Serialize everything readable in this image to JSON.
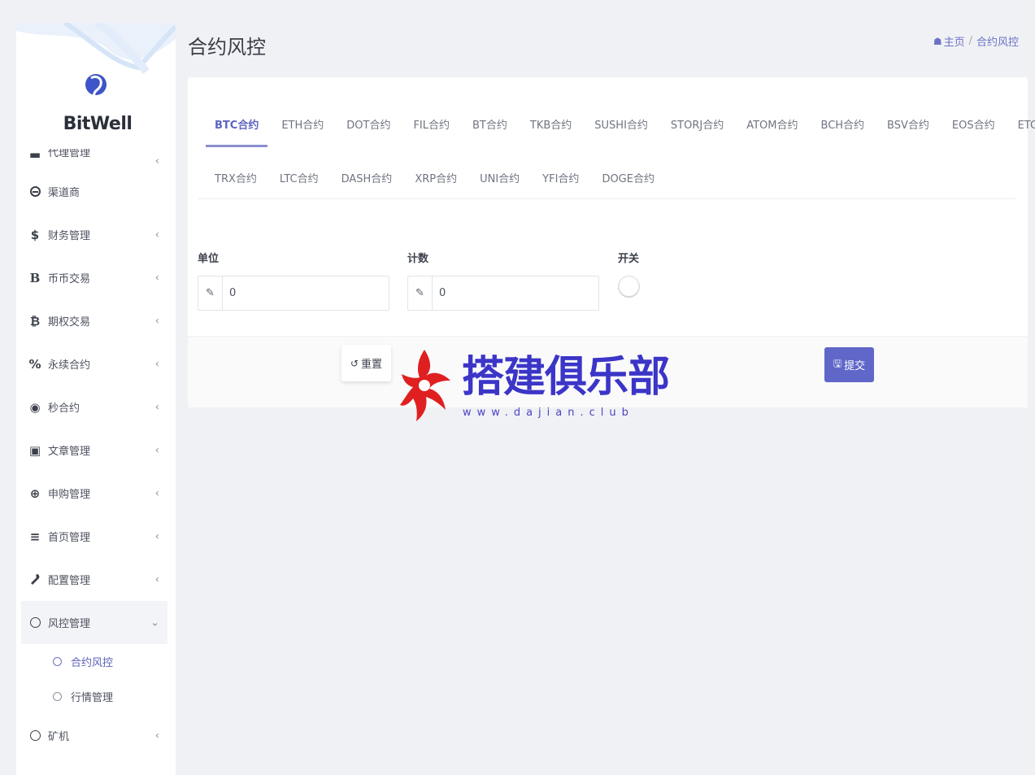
{
  "brand": {
    "name": "BitWell"
  },
  "sidebar": {
    "partial_item": {
      "label": "代理管理"
    },
    "items": [
      {
        "label": "渠道商",
        "icon": "person-icon",
        "glyph": "⊖",
        "has_children": false
      },
      {
        "label": "财务管理",
        "icon": "dollar-icon",
        "glyph": "$",
        "has_children": true
      },
      {
        "label": "币币交易",
        "icon": "b-letter-icon",
        "glyph": "B",
        "has_children": true
      },
      {
        "label": "期权交易",
        "icon": "bitcoin-icon",
        "glyph": "₿",
        "has_children": true
      },
      {
        "label": "永续合约",
        "icon": "percent-icon",
        "glyph": "%",
        "has_children": true
      },
      {
        "label": "秒合约",
        "icon": "target-icon",
        "glyph": "◉",
        "has_children": true
      },
      {
        "label": "文章管理",
        "icon": "newspaper-icon",
        "glyph": "▣",
        "has_children": true
      },
      {
        "label": "申购管理",
        "icon": "lifebuoy-icon",
        "glyph": "⊕",
        "has_children": true
      },
      {
        "label": "首页管理",
        "icon": "list-icon",
        "glyph": "≡",
        "has_children": true
      },
      {
        "label": "配置管理",
        "icon": "wrench-icon",
        "glyph": "🔧",
        "has_children": true
      }
    ],
    "open_item": {
      "label": "风控管理",
      "icon": "circle-icon"
    },
    "sub_items": [
      {
        "label": "合约风控",
        "active": true
      },
      {
        "label": "行情管理",
        "active": false
      }
    ],
    "last_item": {
      "label": "矿机",
      "icon": "circle-icon"
    }
  },
  "header": {
    "title": "合约风控",
    "breadcrumb": {
      "home": "主页",
      "current": "合约风控"
    }
  },
  "tabs": {
    "row1": [
      "BTC合约",
      "ETH合约",
      "DOT合约",
      "FIL合约",
      "BT合约",
      "TKB合约",
      "SUSHI合约",
      "STORJ合约",
      "ATOM合约",
      "BCH合约",
      "BSV合约",
      "EOS合约",
      "ETC合约"
    ],
    "row2": [
      "TRX合约",
      "LTC合约",
      "DASH合约",
      "XRP合约",
      "UNI合约",
      "YFI合约",
      "DOGE合约"
    ],
    "active": "BTC合约"
  },
  "form": {
    "unit": {
      "label": "单位",
      "value": "0"
    },
    "count": {
      "label": "计数",
      "value": "0"
    },
    "switch": {
      "label": "开关",
      "on": false
    }
  },
  "actions": {
    "reset": "重置",
    "submit": "提交"
  },
  "watermark": {
    "text": "搭建俱乐部",
    "url": "www.dajian.club"
  },
  "colors": {
    "accent": "#6167c9",
    "watermark": "#3b35c8",
    "watermark_logo": "#e02020"
  }
}
